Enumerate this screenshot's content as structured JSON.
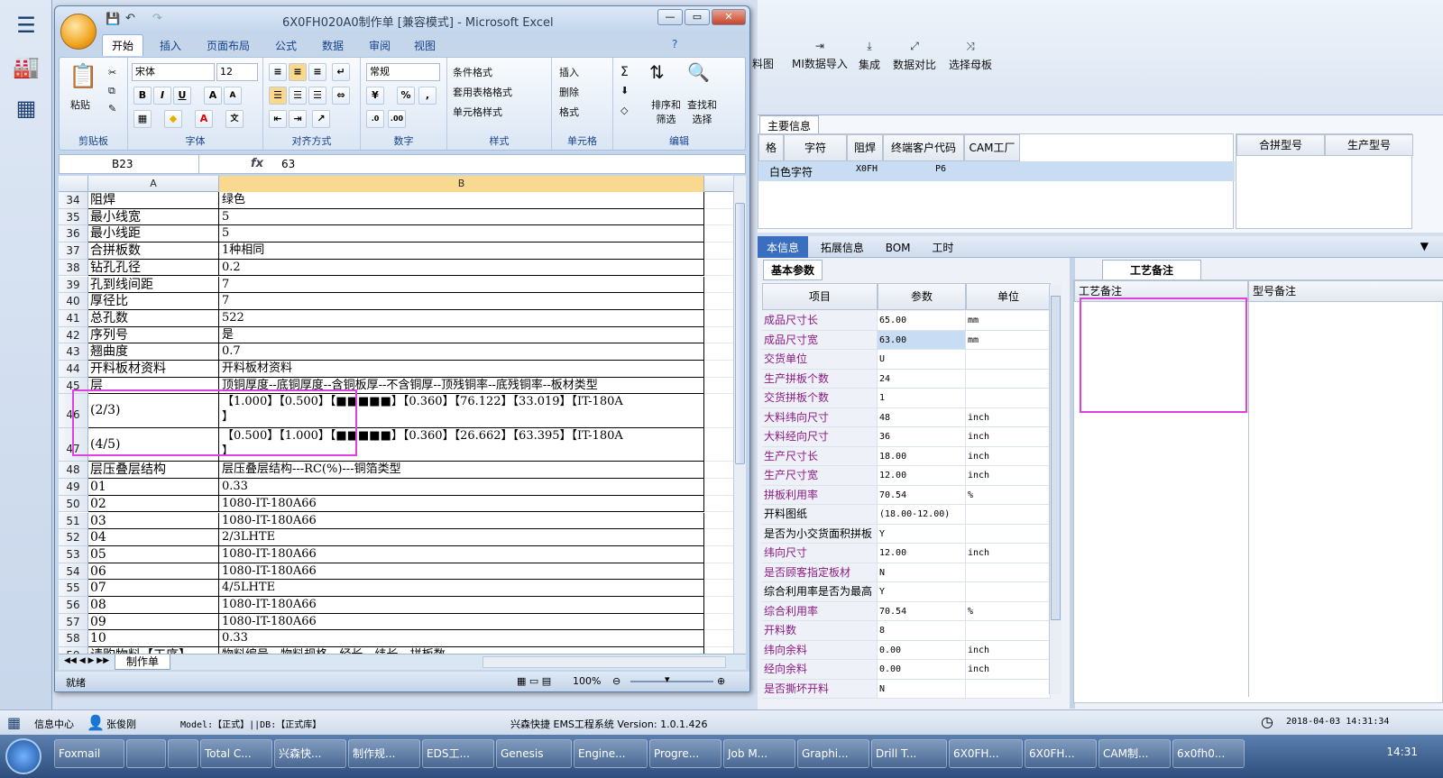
{
  "excel": {
    "title": "6X0FH020A0制作单 [兼容模式] - Microsoft Excel",
    "tabs": [
      "开始",
      "插入",
      "页面布局",
      "公式",
      "数据",
      "审阅",
      "视图"
    ],
    "ribbon": {
      "clipboard": {
        "paste": "粘贴",
        "label": "剪贴板"
      },
      "font": {
        "name": "宋体",
        "size": "12",
        "label": "字体"
      },
      "align": {
        "label": "对齐方式"
      },
      "number": {
        "format": "常规",
        "label": "数字"
      },
      "styles": {
        "cond": "条件格式",
        "table": "套用表格格式",
        "cell": "单元格样式",
        "label": "样式"
      },
      "cells": {
        "insert": "插入",
        "delete": "删除",
        "format": "格式",
        "label": "单元格"
      },
      "edit": {
        "sort": "排序和\n筛选",
        "find": "查找和\n选择",
        "label": "编辑"
      }
    },
    "name_box": "B23",
    "formula_value": "63",
    "columns": [
      "A",
      "B"
    ],
    "rows": [
      {
        "n": "34",
        "a": "阻焊",
        "b": "绿色"
      },
      {
        "n": "35",
        "a": "最小线宽",
        "b": "5"
      },
      {
        "n": "36",
        "a": "最小线距",
        "b": "5"
      },
      {
        "n": "37",
        "a": "合拼板数",
        "b": "1种相同"
      },
      {
        "n": "38",
        "a": "钻孔孔径",
        "b": "0.2"
      },
      {
        "n": "39",
        "a": "孔到线间距",
        "b": "7"
      },
      {
        "n": "40",
        "a": "厚径比",
        "b": "7"
      },
      {
        "n": "41",
        "a": "总孔数",
        "b": "522"
      },
      {
        "n": "42",
        "a": "序列号",
        "b": "是"
      },
      {
        "n": "43",
        "a": "翘曲度",
        "b": "0.7"
      },
      {
        "n": "44",
        "a": "开料板材资料",
        "b": "开料板材资料"
      },
      {
        "n": "45",
        "a": "层",
        "b": "顶铜厚度--底铜厚度--含铜板厚--不含铜厚--顶残铜率--底残铜率--板材类型"
      },
      {
        "n": "46",
        "a": "(2/3)",
        "b": "【1.000】【0.500】【■■■■■】【0.360】【76.122】【33.019】【IT-180A",
        "b2": "】"
      },
      {
        "n": "47",
        "a": "(4/5)",
        "b": "【0.500】【1.000】【■■■■■】【0.360】【26.662】【63.395】【IT-180A",
        "b2": "】"
      },
      {
        "n": "48",
        "a": "层压叠层结构",
        "b": "层压叠层结构---RC(%)---铜箔类型"
      },
      {
        "n": "49",
        "a": "01",
        "b": "0.33"
      },
      {
        "n": "50",
        "a": "02",
        "b": "1080-IT-180A66"
      },
      {
        "n": "51",
        "a": "03",
        "b": "1080-IT-180A66"
      },
      {
        "n": "52",
        "a": "04",
        "b": "2/3LHTE"
      },
      {
        "n": "53",
        "a": "05",
        "b": "1080-IT-180A66"
      },
      {
        "n": "54",
        "a": "06",
        "b": "1080-IT-180A66"
      },
      {
        "n": "55",
        "a": "07",
        "b": "4/5LHTE"
      },
      {
        "n": "56",
        "a": "08",
        "b": "1080-IT-180A66"
      },
      {
        "n": "57",
        "a": "09",
        "b": "1080-IT-180A66"
      },
      {
        "n": "58",
        "a": "10",
        "b": "0.33"
      },
      {
        "n": "59",
        "a": "请购物料【工序】",
        "b": "物料编号---物料规格---经长---纬长---拼板数"
      }
    ],
    "sheet_tab": "制作单",
    "status_ready": "就绪",
    "zoom": "100%"
  },
  "ems": {
    "ribbon_buttons": [
      "料图",
      "MI数据导入",
      "集成",
      "数据对比",
      "选择母板"
    ],
    "main_info_tab": "主要信息",
    "top_cols": [
      "格",
      "字符",
      "阻焊",
      "终端客户代码",
      "CAM工厂"
    ],
    "top_row": [
      "",
      "白色字符",
      "",
      "X0FH",
      "P6"
    ],
    "right_cols": [
      "合拼型号",
      "生产型号"
    ],
    "mid_tabs": [
      "本信息",
      "拓展信息",
      "BOM",
      "工时"
    ],
    "basic_tab": "基本参数",
    "param_cols": [
      "项目",
      "参数",
      "单位"
    ],
    "params": [
      {
        "k": "成品尺寸长",
        "v": "65.00",
        "u": "mm",
        "p": true
      },
      {
        "k": "成品尺寸宽",
        "v": "63.00",
        "u": "mm",
        "p": true
      },
      {
        "k": "交货单位",
        "v": "U",
        "u": "",
        "p": true
      },
      {
        "k": "生产拼板个数",
        "v": "24",
        "u": "",
        "p": true
      },
      {
        "k": "交货拼板个数",
        "v": "1",
        "u": "",
        "p": true
      },
      {
        "k": "大料纬向尺寸",
        "v": "48",
        "u": "inch",
        "p": true
      },
      {
        "k": "大料经向尺寸",
        "v": "36",
        "u": "inch",
        "p": true
      },
      {
        "k": "生产尺寸长",
        "v": "18.00",
        "u": "inch",
        "p": true
      },
      {
        "k": "生产尺寸宽",
        "v": "12.00",
        "u": "inch",
        "p": true
      },
      {
        "k": "拼板利用率",
        "v": "70.54",
        "u": "%",
        "p": true
      },
      {
        "k": "开料图纸",
        "v": "(18.00-12.00)",
        "u": "",
        "p": false
      },
      {
        "k": "是否为小交货面积拼板",
        "v": "Y",
        "u": "",
        "p": false
      },
      {
        "k": "纬向尺寸",
        "v": "12.00",
        "u": "inch",
        "p": true
      },
      {
        "k": "是否顾客指定板材",
        "v": "N",
        "u": "",
        "p": true
      },
      {
        "k": "综合利用率是否为最高",
        "v": "Y",
        "u": "",
        "p": false
      },
      {
        "k": "综合利用率",
        "v": "70.54",
        "u": "%",
        "p": true
      },
      {
        "k": "开料数",
        "v": "8",
        "u": "",
        "p": true
      },
      {
        "k": "纬向余料",
        "v": "0.00",
        "u": "inch",
        "p": true
      },
      {
        "k": "经向余料",
        "v": "0.00",
        "u": "inch",
        "p": true
      },
      {
        "k": "是否撕坏开料",
        "v": "N",
        "u": "",
        "p": true
      }
    ],
    "process_tab": "工艺备注",
    "process_cols": [
      "工艺备注",
      "型号备注"
    ],
    "status": {
      "info": "信息中心",
      "user": "张俊刚",
      "model": "Model:【正式】||DB:【正式库】",
      "system": "兴森快捷 EMS工程系统 Version: 1.0.1.426",
      "datetime": "2018-04-03 14:31:34"
    }
  },
  "taskbar": {
    "items": [
      "Foxmail",
      "",
      "",
      "Total C...",
      "兴森快...",
      "制作规...",
      "EDS工...",
      "Genesis",
      "Engine...",
      "Progre...",
      "Job M...",
      "Graphi...",
      "Drill T...",
      "6X0FH...",
      "6X0FH...",
      "CAM制...",
      "6x0fh0..."
    ],
    "clock": "14:31"
  }
}
